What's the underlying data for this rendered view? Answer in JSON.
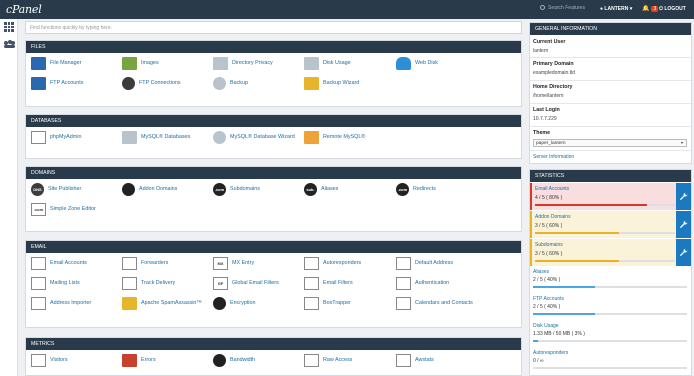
{
  "topbar": {
    "logo": "cPanel",
    "search_placeholder": "Search Features",
    "user": "LANTERN",
    "notifications": "3",
    "logout": "LOGOUT"
  },
  "search": {
    "placeholder": "Find functions quickly by typing here."
  },
  "files": {
    "title": "FILES",
    "items": [
      "File Manager",
      "Images",
      "Directory Privacy",
      "Disk Usage",
      "Web Disk",
      "FTP Accounts",
      "FTP Connections",
      "Backup",
      "Backup Wizard"
    ]
  },
  "databases": {
    "title": "DATABASES",
    "items": [
      "phpMyAdmin",
      "MySQL® Databases",
      "MySQL® Database Wizard",
      "Remote MySQL®"
    ]
  },
  "domains": {
    "title": "DOMAINS",
    "items": [
      "Site Publisher",
      "Addon Domains",
      "Subdomains",
      "Aliases",
      "Redirects",
      "Simple Zone Editor"
    ]
  },
  "email": {
    "title": "EMAIL",
    "items": [
      "Email Accounts",
      "Forwarders",
      "MX Entry",
      "Autoresponders",
      "Default Address",
      "Mailing Lists",
      "Track Delivery",
      "Global Email Filters",
      "Email Filters",
      "Authentication",
      "Address Importer",
      "Apache SpamAssassin™",
      "Encryption",
      "BoxTrapper",
      "Calendars and Contacts"
    ]
  },
  "metrics": {
    "title": "METRICS",
    "items": [
      "Visitors",
      "Errors",
      "Bandwidth",
      "Raw Access",
      "Awstats"
    ]
  },
  "icons": {
    "files": [
      "file-manager-icon",
      "images-icon",
      "directory-privacy-icon",
      "disk-usage-icon",
      "web-disk-icon",
      "ftp-accounts-icon",
      "ftp-connections-icon",
      "backup-icon",
      "backup-wizard-icon"
    ],
    "databases": [
      "phpmyadmin-icon",
      "mysql-databases-icon",
      "mysql-wizard-icon",
      "remote-mysql-icon"
    ],
    "domains": [
      "site-publisher-icon",
      "addon-domains-icon",
      "subdomains-icon",
      "aliases-icon",
      "redirects-icon",
      "zone-editor-icon"
    ],
    "email": [
      "email-accounts-icon",
      "forwarders-icon",
      "mx-entry-icon",
      "autoresponders-icon",
      "default-address-icon",
      "mailing-lists-icon",
      "track-delivery-icon",
      "global-filters-icon",
      "email-filters-icon",
      "authentication-icon",
      "address-importer-icon",
      "spamassassin-icon",
      "encryption-icon",
      "boxtrapper-icon",
      "calendars-icon"
    ],
    "metrics": [
      "visitors-icon",
      "errors-icon",
      "bandwidth-icon",
      "raw-access-icon",
      "awstats-icon"
    ]
  },
  "icon_glyphs": {
    "domains": [
      "DNS",
      "",
      ".com",
      "sub.",
      ".com",
      ".com"
    ],
    "email": [
      "",
      "",
      "MX",
      "",
      "",
      "",
      "",
      "GF",
      "",
      "",
      "",
      "",
      "",
      "",
      ""
    ]
  },
  "general": {
    "title": "GENERAL INFORMATION",
    "current_user_label": "Current User",
    "current_user": "lantern",
    "primary_domain_label": "Primary Domain",
    "primary_domain": "exampledomain.tld",
    "home_dir_label": "Home Directory",
    "home_dir": "/home/lantern",
    "last_login_label": "Last Login",
    "last_login": "10.7.7.229",
    "theme_label": "Theme",
    "theme": "paper_lantern",
    "server_info": "Server Information"
  },
  "statistics": {
    "title": "STATISTICS",
    "alerts": [
      {
        "label": "Email Accounts",
        "value": "4 / 5 ( 80% )",
        "percent": 80,
        "level": "red"
      },
      {
        "label": "Addon Domains",
        "value": "3 / 5 ( 60% )",
        "percent": 60,
        "level": "yellow"
      },
      {
        "label": "Subdomains",
        "value": "3 / 5 ( 60% )",
        "percent": 60,
        "level": "yellow"
      }
    ],
    "plain": [
      {
        "label": "Aliases",
        "value": "2 / 5 ( 40% )",
        "percent": 40
      },
      {
        "label": "FTP Accounts",
        "value": "2 / 5 ( 40% )",
        "percent": 40
      },
      {
        "label": "Disk Usage",
        "value": "1.33 MB / 50 MB ( 3% )",
        "percent": 3
      },
      {
        "label": "Autoresponders",
        "value": "0 / ∞",
        "percent": 0
      }
    ]
  },
  "colors": {
    "header": "#293a4a",
    "link": "#1c6ea4",
    "red": "#d43a2c",
    "yellow": "#e8b326",
    "blue_fill": "#4aa6e0",
    "wrench": "#1b79c0"
  }
}
